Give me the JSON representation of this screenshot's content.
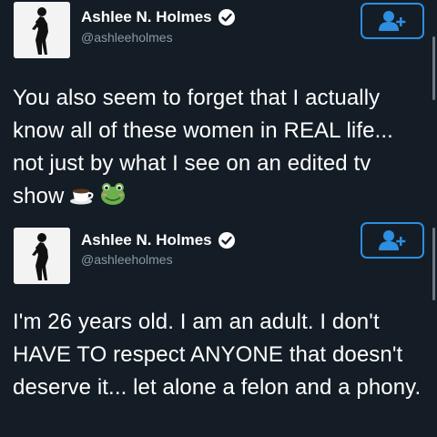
{
  "tweets": [
    {
      "author": {
        "name": "Ashlee N. Holmes",
        "handle": "@ashleeholmes",
        "verified": true,
        "avatar": "person-silhouette-icon"
      },
      "follow_button_icon": "add-user-icon",
      "text": "You also seem to forget that I actually know all of these women in REAL life... not just by what I see on an edited tv show",
      "emojis": [
        "coffee-cup-emoji",
        "frog-emoji"
      ]
    },
    {
      "author": {
        "name": "Ashlee N. Holmes",
        "handle": "@ashleeholmes",
        "verified": true,
        "avatar": "person-silhouette-icon"
      },
      "follow_button_icon": "add-user-icon",
      "text": "I'm 26 years old. I am an adult. I don't HAVE TO respect ANYONE that doesn't deserve it... let alone a felon and a phony.",
      "emojis": []
    }
  ],
  "colors": {
    "background": "#141d26",
    "accent": "#2e8ee0",
    "handle": "#8899a6",
    "text": "#ffffff"
  }
}
